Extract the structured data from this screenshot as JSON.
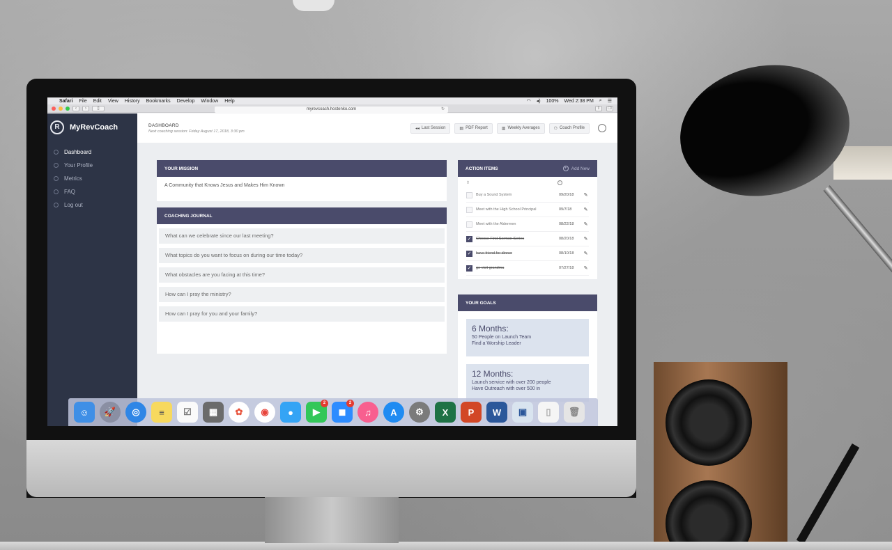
{
  "menubar": {
    "app": "Safari",
    "items": [
      "File",
      "Edit",
      "View",
      "History",
      "Bookmarks",
      "Develop",
      "Window",
      "Help"
    ],
    "battery": "100%",
    "clock": "Wed 2:38 PM"
  },
  "browser": {
    "url": "myrevcoach.hostenko.com"
  },
  "brand": {
    "logo": "R",
    "name": "MyRevCoach"
  },
  "sidebar": {
    "items": [
      {
        "label": "Dashboard",
        "icon": "gauge-icon"
      },
      {
        "label": "Your Profile",
        "icon": "user-icon"
      },
      {
        "label": "Metrics",
        "icon": "chart-icon"
      },
      {
        "label": "FAQ",
        "icon": "help-icon"
      },
      {
        "label": "Log out",
        "icon": "logout-icon"
      }
    ]
  },
  "topbar": {
    "title": "DASHBOARD",
    "subtitle": "Next coaching session: Friday August 17, 2018, 3:30 pm",
    "buttons": [
      "Last Session",
      "PDF Report",
      "Weekly Averages",
      "Coach Profile"
    ]
  },
  "mission": {
    "heading": "YOUR MISSION",
    "text": "A Community that Knows Jesus and Makes Him Known"
  },
  "journal": {
    "heading": "COACHING JOURNAL",
    "questions": [
      "What can we celebrate since our last meeting?",
      "What topics do you want to focus on during our time today?",
      "What obstacles are you facing at this time?",
      "How can I pray the ministry?",
      "How can I pray for you and your family?"
    ]
  },
  "action_items": {
    "heading": "ACTION ITEMS",
    "add_label": "Add New",
    "items": [
      {
        "text": "Buy a Sound System",
        "date": "09/20/18",
        "done": false
      },
      {
        "text": "Meet with the High School Principal",
        "date": "09/7/18",
        "done": false
      },
      {
        "text": "Meet with the Aldermen",
        "date": "08/22/18",
        "done": false
      },
      {
        "text": "Choose First Sermon Series",
        "date": "08/20/18",
        "done": true
      },
      {
        "text": "have friend for dinner",
        "date": "08/10/18",
        "done": true
      },
      {
        "text": "go visit grandma",
        "date": "07/27/18",
        "done": true
      }
    ]
  },
  "goals": {
    "heading": "YOUR GOALS",
    "items": [
      {
        "title": "6 Months:",
        "lines": [
          "50 People on Launch Team",
          "Find a Worship Leader"
        ]
      },
      {
        "title": "12 Months:",
        "lines": [
          "Launch service with over 200 people",
          "Have Outreach with over 500 in"
        ]
      }
    ]
  },
  "dock": {
    "messages_badge": "2",
    "zoom_badge": "2",
    "excel_letter": "X",
    "powerpoint_letter": "P",
    "word_letter": "W"
  }
}
